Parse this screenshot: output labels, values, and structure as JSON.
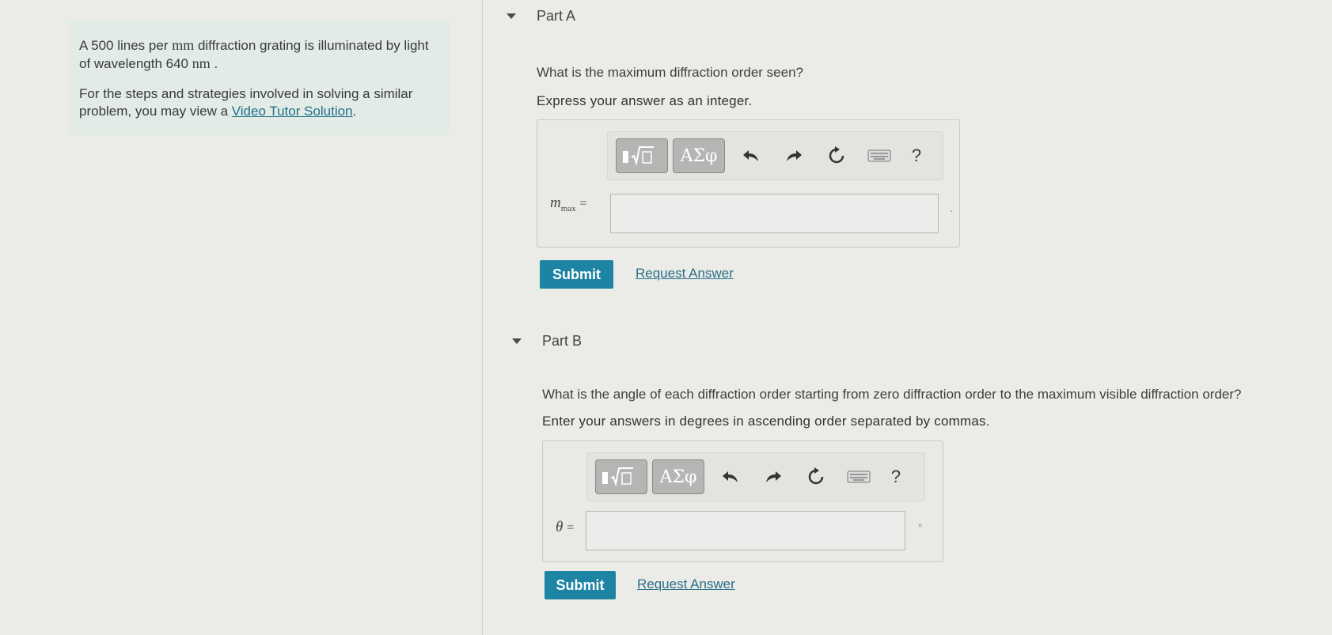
{
  "intro": {
    "p1_before": "A 500 lines per ",
    "p1_unit1": "mm",
    "p1_middle": " diffraction grating is illuminated by light of wavelength 640 ",
    "p1_unit2": "nm",
    "p1_after": " .",
    "p2_before": "For the steps and strategies involved in solving a similar problem, you may view a ",
    "p2_link": "Video Tutor Solution",
    "p2_after": "."
  },
  "part_a": {
    "header": "Part A",
    "question": "What is the maximum diffraction order seen?",
    "instruction": "Express your answer as an integer.",
    "var_main": "m",
    "var_sub": "max",
    "equals": "=",
    "input_value": "",
    "unit": ".",
    "submit": "Submit",
    "request": "Request Answer"
  },
  "part_b": {
    "header": "Part B",
    "question": "What is the angle of each diffraction order starting from zero diffraction order to the maximum visible diffraction order?",
    "instruction": "Enter your answers in degrees in ascending order separated by commas.",
    "var_main": "θ",
    "equals": "=",
    "input_value": "",
    "unit": "°",
    "submit": "Submit",
    "request": "Request Answer"
  },
  "toolbar": {
    "templates_icon": "templates-sqrt-icon",
    "greek_label": "ΑΣφ",
    "undo_icon": "undo-icon",
    "redo_icon": "redo-icon",
    "reset_icon": "reset-icon",
    "keyboard_icon": "keyboard-icon",
    "help_label": "?"
  },
  "colors": {
    "accent": "#1d84a4",
    "link": "#1f6f8b",
    "intro_bg": "#e2ebe5"
  }
}
